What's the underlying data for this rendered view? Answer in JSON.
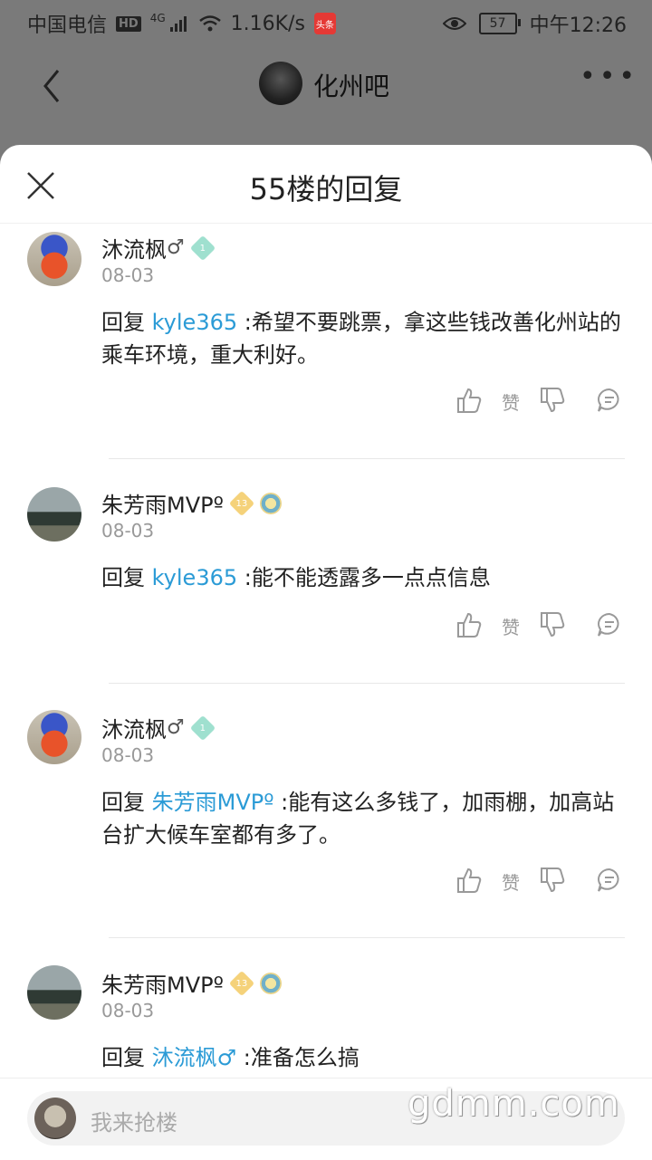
{
  "status": {
    "carrier": "中国电信",
    "hd": "HD",
    "network": "4G",
    "speed": "1.16K/s",
    "app_badge": "头条",
    "battery": "57",
    "time": "中午12:26"
  },
  "header": {
    "forum_title": "化州吧"
  },
  "sheet": {
    "title": "55楼的回复"
  },
  "replies": [
    {
      "user": "沐流枫",
      "gender": "♂",
      "level": "1",
      "date": "08-03",
      "reply_prefix": "回复",
      "mention": "kyle365",
      "text": " :希望不要跳票，拿这些钱改善化州站的乘车环境，重大利好。",
      "like_label": "赞"
    },
    {
      "user": "朱芳雨MVPº",
      "level": "13",
      "date": "08-03",
      "reply_prefix": "回复",
      "mention": "kyle365",
      "text": " :能不能透露多一点点信息",
      "like_label": "赞"
    },
    {
      "user": "沐流枫",
      "gender": "♂",
      "level": "1",
      "date": "08-03",
      "reply_prefix": "回复",
      "mention": "朱芳雨MVPº",
      "text": " :能有这么多钱了，加雨棚，加高站台扩大候车室都有多了。",
      "like_label": "赞"
    },
    {
      "user": "朱芳雨MVPº",
      "level": "13",
      "date": "08-03",
      "reply_prefix": "回复",
      "mention": "沐流枫♂",
      "text": " :准备怎么搞"
    }
  ],
  "bottom": {
    "placeholder": "我来抢楼"
  },
  "watermark": "gdmm.com"
}
